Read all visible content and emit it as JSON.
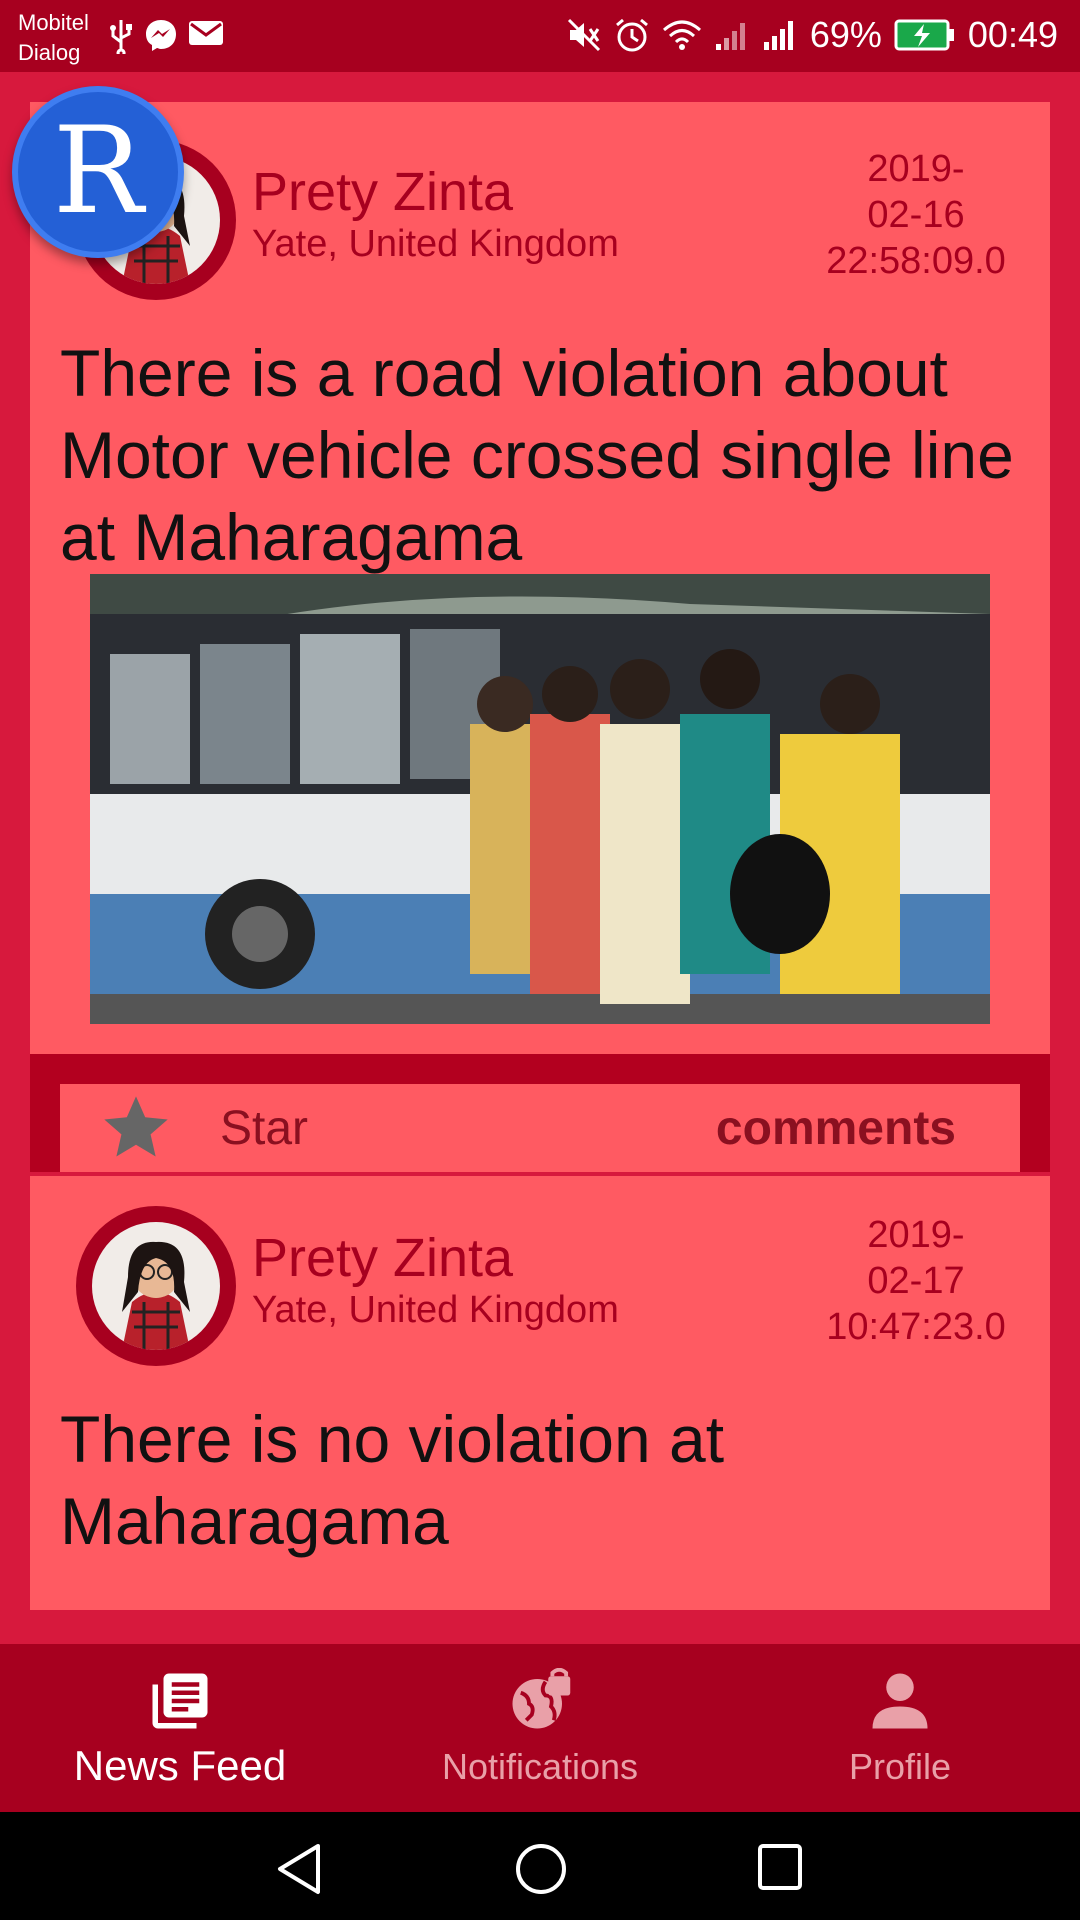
{
  "status_bar": {
    "carrier_1": "Mobitel",
    "carrier_2": "Dialog",
    "battery": "69%",
    "time": "00:49"
  },
  "posts": [
    {
      "author": "Prety Zinta",
      "location": "Yate, United Kingdom",
      "date_line1": "2019-",
      "date_line2": "02-16",
      "date_line3": "22:58:09.0",
      "text": "There is a road violation about Motor vehicle crossed single line at Maharagama",
      "star_label": "Star",
      "comments_label": "comments"
    },
    {
      "author": "Prety Zinta",
      "location": "Yate, United Kingdom",
      "date_line1": "2019-",
      "date_line2": "02-17",
      "date_line3": "10:47:23.0",
      "text": "There is no violation at Maharagama"
    }
  ],
  "badge_letter": "R",
  "bottom_nav": {
    "items": [
      {
        "label": "News Feed",
        "icon": "news-feed-icon",
        "active": true
      },
      {
        "label": "Notifications",
        "icon": "globe-lock-icon",
        "active": false
      },
      {
        "label": "Profile",
        "icon": "person-icon",
        "active": false
      }
    ]
  },
  "colors": {
    "primary_dark": "#a7001f",
    "card": "#ff5a62",
    "background": "#d7193d"
  }
}
